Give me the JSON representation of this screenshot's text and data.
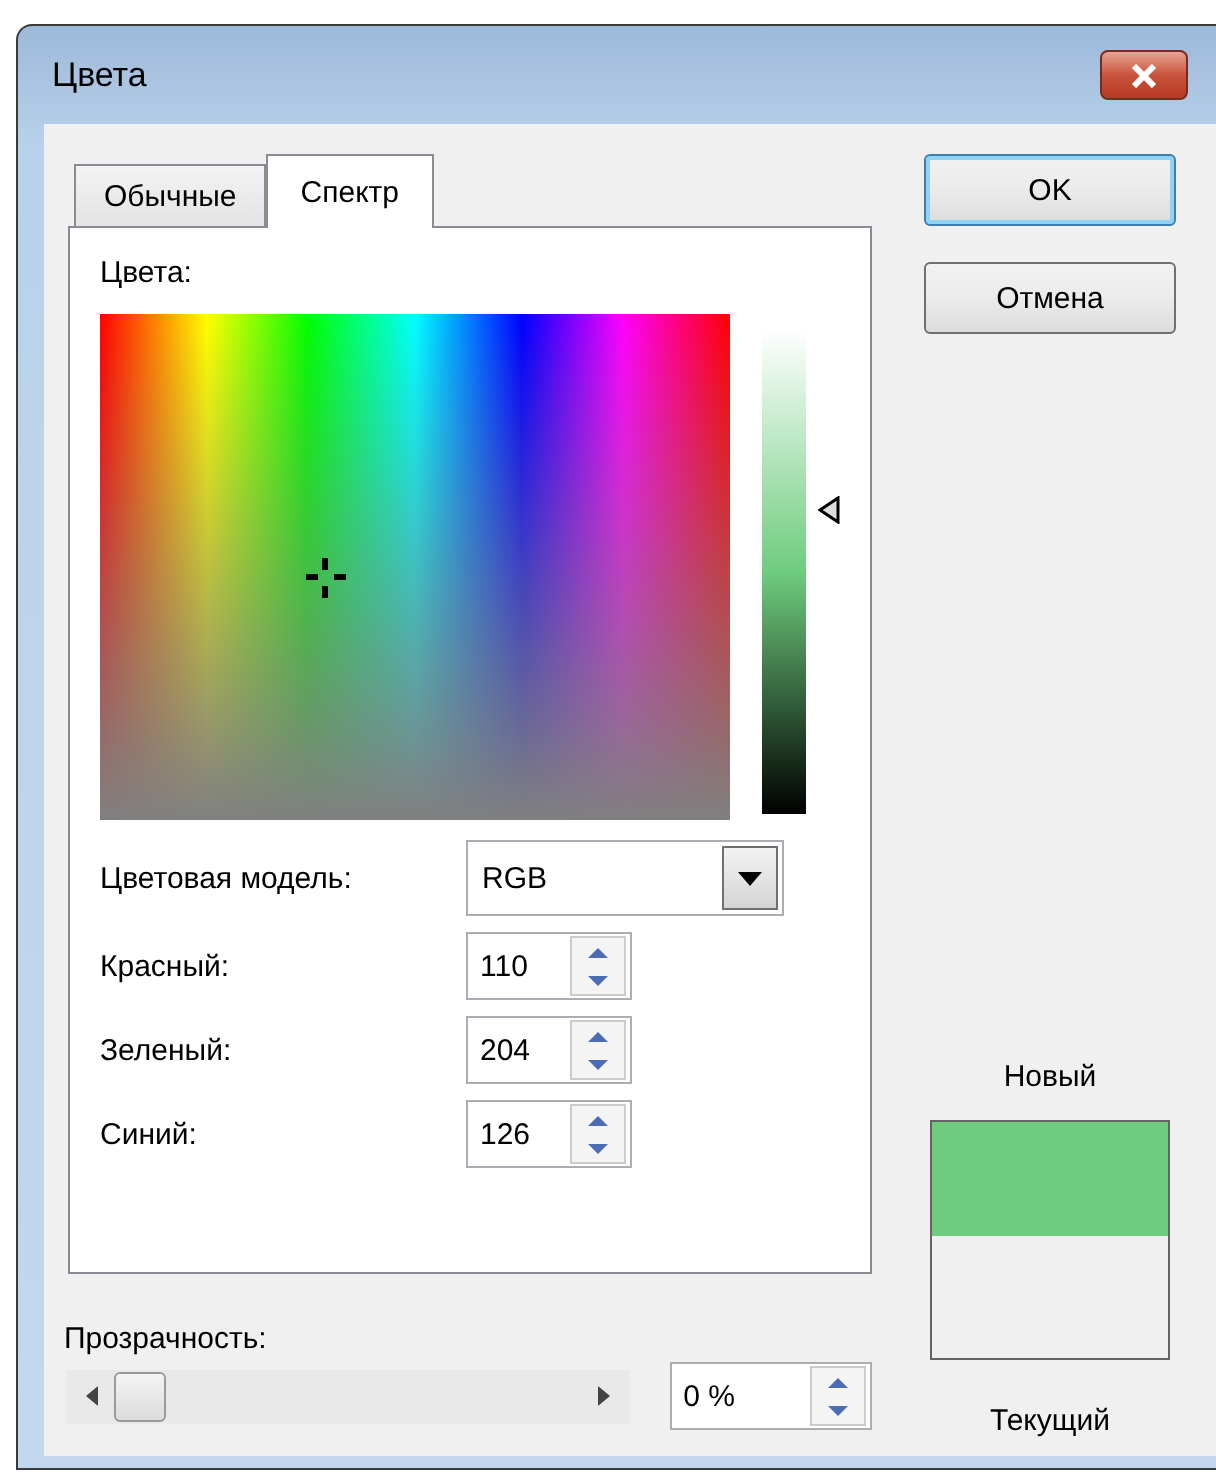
{
  "window": {
    "title": "Цвета"
  },
  "tabs": [
    {
      "label": "Обычные",
      "selected": false
    },
    {
      "label": "Спектр",
      "selected": true
    }
  ],
  "colors_label": "Цвета:",
  "lightness": {
    "level": 0.63
  },
  "color_model": {
    "label": "Цветовая модель:",
    "value": "RGB"
  },
  "channels": [
    {
      "label": "Красный:",
      "value": "110"
    },
    {
      "label": "Зеленый:",
      "value": "204"
    },
    {
      "label": "Синий:",
      "value": "126"
    }
  ],
  "transparency": {
    "label": "Прозрачность:",
    "value": "0 %"
  },
  "buttons": [
    "OK",
    "Отмена"
  ],
  "preview": {
    "new_label": "Новый",
    "current_label": "Текущий"
  }
}
